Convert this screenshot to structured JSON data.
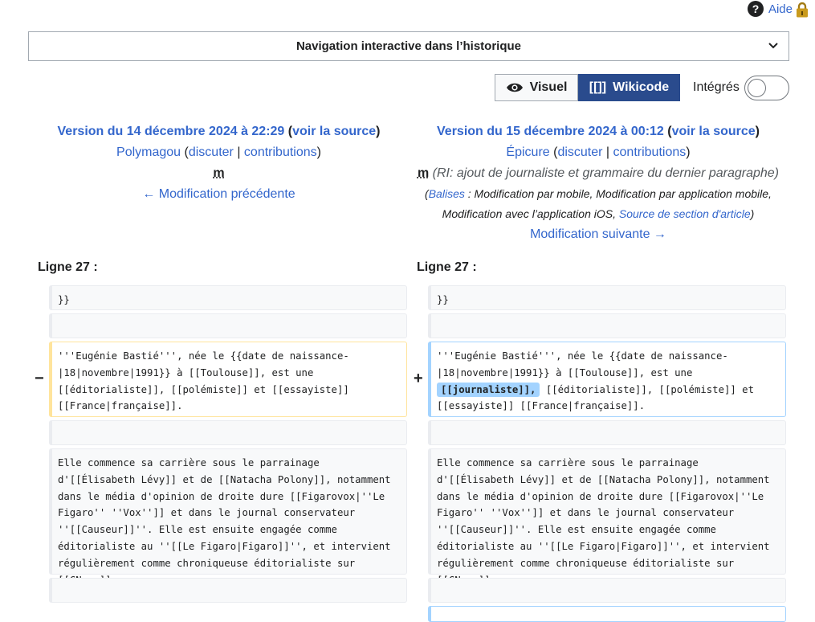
{
  "help": {
    "label": "Aide",
    "icon": "question-icon",
    "lock_icon": "lock-icon"
  },
  "nav": {
    "title": "Navigation interactive dans l’historique",
    "icon": "chevron-down-icon"
  },
  "view_toggle": {
    "visual_label": "Visuel",
    "visual_icon": "eye-icon",
    "wikicode_label": "Wikicode",
    "wikicode_icon_text": "[[]]",
    "active": "Wikicode"
  },
  "inline": {
    "label": "Intégrés",
    "checked": false
  },
  "left_rev": {
    "title": "Version du 14 décembre 2024 à 22:29",
    "source_link": "voir la source",
    "user": "Polymagou",
    "talk": "discuter",
    "contribs": "contributions",
    "minor": "m",
    "nav_link": "← Modification précédente"
  },
  "right_rev": {
    "title": "Version du 15 décembre 2024 à 00:12",
    "source_link": "voir la source",
    "user": "Épicure",
    "talk": "discuter",
    "contribs": "contributions",
    "minor": "m",
    "summary": "(RI: ajout de journaliste et grammaire du dernier paragraphe)",
    "tags_label": "Balises",
    "tags_text": " : Modification par mobile, Modification par application mobile, Modification avec l’application iOS, ",
    "tags_link": "Source de section d'article",
    "nav_link": "Modification suivante →"
  },
  "diff": {
    "left_line": "Ligne 27 :",
    "right_line": "Ligne 27 :",
    "del_marker": "−",
    "add_marker": "+",
    "context_1": "}}",
    "left_changed": "'''Eugénie Bastié''', née le {{date de naissance-|18|novembre|1991}} à [[Toulouse]], est une [[éditorialiste]], [[polémiste]] et [[essayiste]] [[France|française]].",
    "right_changed_before": "'''Eugénie Bastié''', née le {{date de naissance-|18|novembre|1991}} à [[Toulouse]], est une ",
    "right_changed_insert": "[[journaliste]],",
    "right_changed_after": " [[éditorialiste]], [[polémiste]] et [[essayiste]] [[France|française]].",
    "paragraph_2": "Elle commence sa carrière sous le parrainage d'[[Élisabeth Lévy]] et de [[Natacha Polony]], notamment dans le média d'opinion de droite dure [[Figarovox|''Le Figaro'' ''Vox'']] et dans le journal conservateur ''[[Causeur]]''. Elle est ensuite engagée comme éditorialiste au ''[[Le Figaro|Figaro]]'', et intervient régulièrement comme chroniqueuse éditorialiste sur [[CNews]]."
  }
}
